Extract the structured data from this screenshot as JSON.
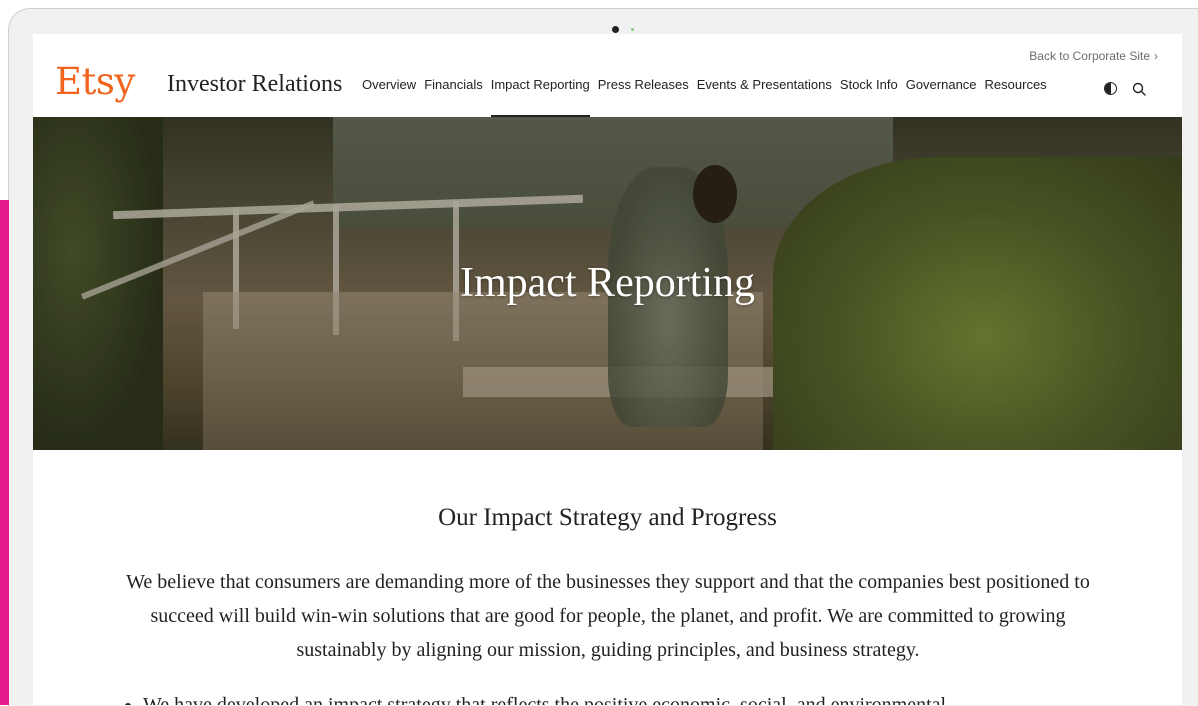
{
  "header": {
    "back_link": "Back to Corporate Site",
    "logo": "Etsy",
    "site_title": "Investor Relations",
    "nav": [
      {
        "label": "Overview"
      },
      {
        "label": "Financials"
      },
      {
        "label": "Impact Reporting",
        "active": true
      },
      {
        "label": "Press Releases"
      },
      {
        "label": "Events & Presentations"
      },
      {
        "label": "Stock Info"
      },
      {
        "label": "Governance"
      },
      {
        "label": "Resources"
      }
    ],
    "icons": [
      "contrast-icon",
      "search-icon"
    ]
  },
  "hero": {
    "title": "Impact Reporting"
  },
  "main": {
    "heading": "Our Impact Strategy and Progress",
    "intro": "We believe that consumers are demanding more of the businesses they support and that the companies best positioned to succeed will build win-win solutions that are good for people, the planet, and profit. We are committed to growing sustainably by aligning our mission, guiding principles, and business strategy.",
    "bullets": [
      "We have developed an impact strategy that reflects the positive economic, social, and environmental"
    ]
  },
  "colors": {
    "brand": "#f1641e",
    "accent_bar": "#e61b8c",
    "text": "#222222"
  }
}
